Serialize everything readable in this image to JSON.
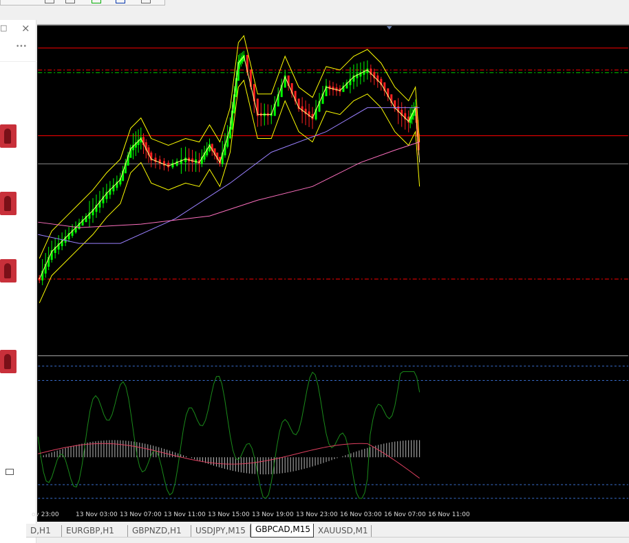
{
  "sidepanel": {
    "more_label": "•••",
    "close_label": "×",
    "restore_label": "□"
  },
  "time_axis": [
    "ov 23:00",
    "13 Nov 03:00",
    "13 Nov 07:00",
    "13 Nov 11:00",
    "13 Nov 15:00",
    "13 Nov 19:00",
    "13 Nov 23:00",
    "16 Nov 03:00",
    "16 Nov 07:00",
    "16 Nov 11:00"
  ],
  "tabs": [
    {
      "label": "D,H1"
    },
    {
      "label": "EURGBP,H1"
    },
    {
      "label": "GBPNZD,H1"
    },
    {
      "label": "USDJPY,M15"
    },
    {
      "label": "GBPCAD,M15",
      "active": true
    },
    {
      "label": "XAUUSD,M1"
    }
  ],
  "colors": {
    "bg": "#000000",
    "bull": "#00ff00",
    "bear": "#ff2020",
    "bands": "#ffff00",
    "ma1": "#9a80ff",
    "ma2": "#ff70c0",
    "level": "#ff0000",
    "osc": "#1a8c1a",
    "signal": "#e04060"
  }
}
